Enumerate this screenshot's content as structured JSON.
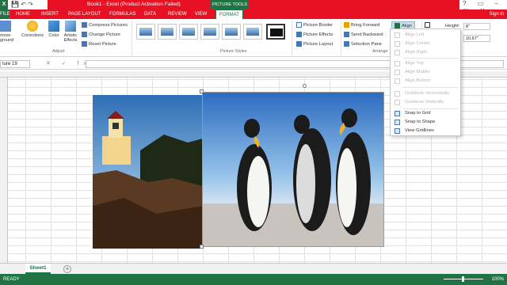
{
  "titlebar": {
    "app_icon": "X",
    "title": "Book1 - Excel (Product Activation Failed)",
    "context_title": "PICTURE TOOLS",
    "window_controls": "?  ▭  –  ▢  ✕"
  },
  "tabs": {
    "file": "FILE",
    "items": [
      "HOME",
      "INSERT",
      "PAGE LAYOUT",
      "FORMULAS",
      "DATA",
      "REVIEW",
      "VIEW"
    ],
    "format": "FORMAT",
    "signin": "Sign in"
  },
  "ribbon": {
    "remove_background": "move\nground",
    "corrections": "Corrections",
    "color": "Color",
    "artistic_effects": "Artistic\nEffects",
    "compress_pictures": "Compress Pictures",
    "change_picture": "Change Picture",
    "reset_picture": "Reset Picture",
    "adjust_label": "Adjust",
    "picture_styles_label": "Picture Styles",
    "picture_border": "Picture Border",
    "picture_effects": "Picture Effects",
    "picture_layout": "Picture Layout",
    "bring_forward": "Bring Forward",
    "send_backward": "Send Backward",
    "selection_pane": "Selection Pane",
    "align": "Align",
    "arrange_label": "Arrange",
    "height_label": "Height:",
    "height_value": "8\"",
    "width_value": "10.67\""
  },
  "formula_bar": {
    "name_box": "ture 19",
    "icons": "✕ ✓ fx"
  },
  "align_menu": {
    "items": [
      {
        "label": "Align Left",
        "enabled": false
      },
      {
        "label": "Align Center",
        "enabled": false
      },
      {
        "label": "Align Right",
        "enabled": false
      },
      {
        "label": "Align Top",
        "enabled": false
      },
      {
        "label": "Align Middle",
        "enabled": false
      },
      {
        "label": "Align Bottom",
        "enabled": false
      },
      {
        "label": "Distribute Horizontally",
        "enabled": false
      },
      {
        "label": "Distribute Vertically",
        "enabled": false
      },
      {
        "label": "Snap to Grid",
        "enabled": true
      },
      {
        "label": "Snap to Shape",
        "enabled": true
      },
      {
        "label": "View Gridlines",
        "enabled": true
      }
    ]
  },
  "sheets": {
    "active": "Sheet1",
    "add": "+"
  },
  "status": {
    "ready": "READY",
    "zoom": "100%"
  },
  "colors": {
    "excel_green": "#217346",
    "activation_red": "#e81123"
  }
}
